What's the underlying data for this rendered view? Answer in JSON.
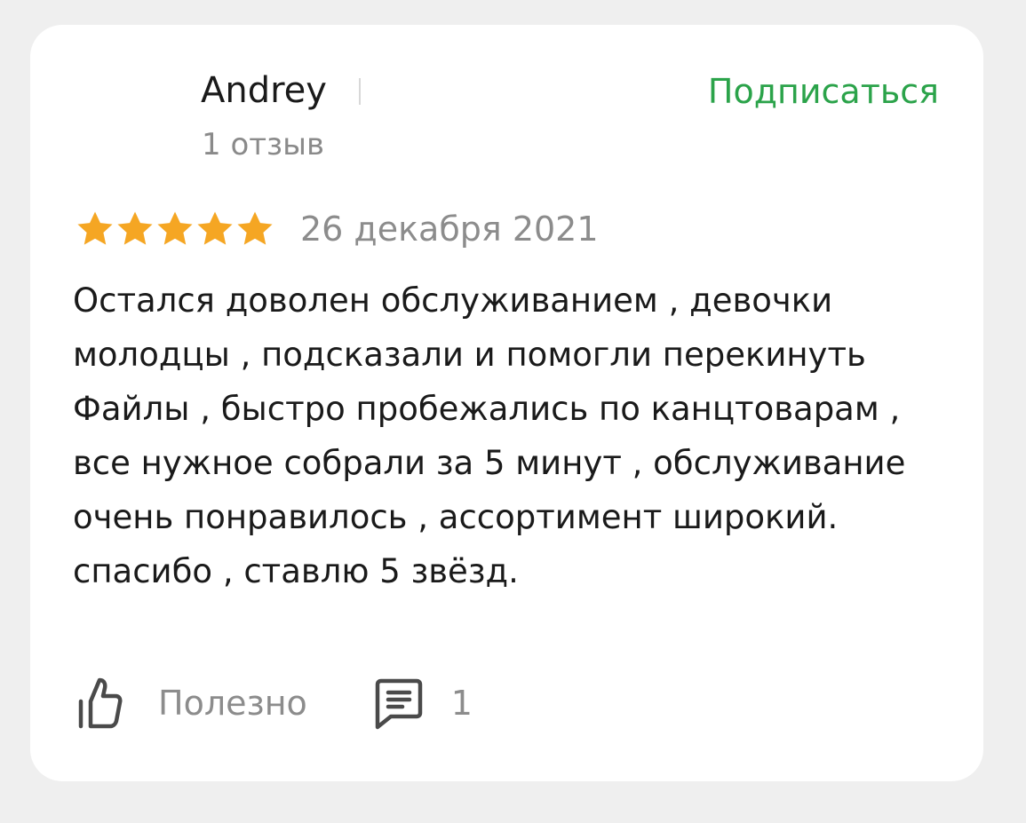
{
  "review": {
    "author": {
      "name": "Andrey",
      "reviews_count": "1 отзыв"
    },
    "subscribe_label": "Подписаться",
    "rating": 5,
    "rating_max": 5,
    "date": "26 декабря 2021",
    "text": "Остался доволен обслуживанием , девочки молодцы , подсказали и помогли перекинуть Файлы , быстро пробежались по канцтоварам , все нужное собрали за 5 минут , обслуживание очень понравилось , ассортимент широкий. спасибо , ставлю 5 звёзд.",
    "actions": {
      "helpful_label": "Полезно",
      "comments_count": "1"
    }
  },
  "colors": {
    "accent_green": "#2ba34a",
    "star_gold": "#f5a623",
    "muted_text": "#8c8c8c",
    "icon_gray": "#4a4a4a"
  },
  "icons": {
    "stars": "star-icon",
    "helpful": "thumbs-up-icon",
    "comments": "comment-icon"
  }
}
